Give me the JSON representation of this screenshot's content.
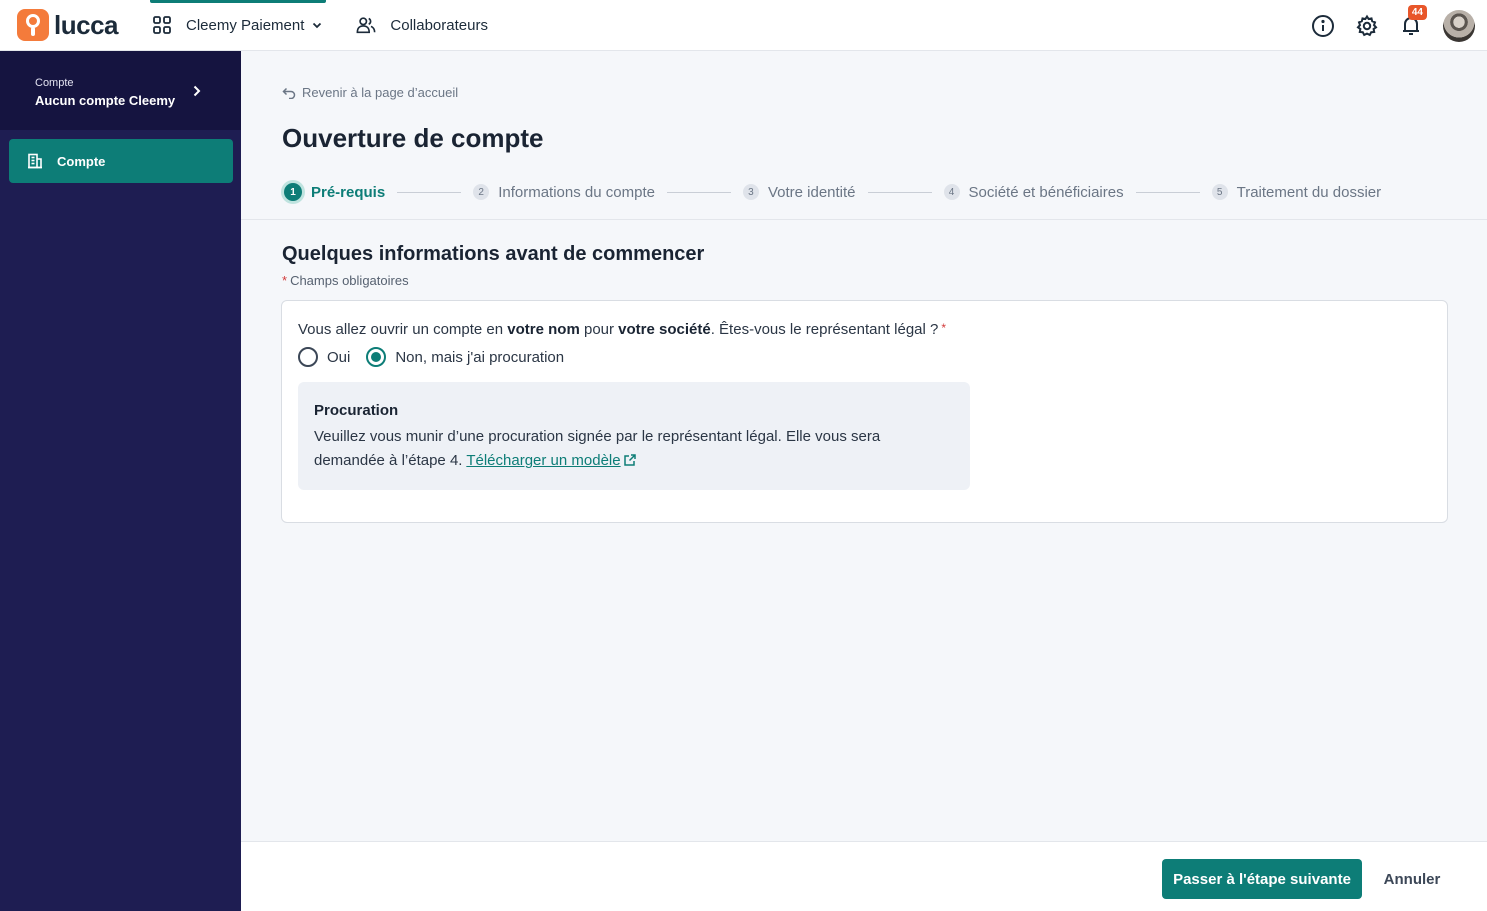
{
  "header": {
    "logo_text": "lucca",
    "app_switcher_label": "Cleemy Paiement",
    "collaborators_label": "Collaborateurs",
    "notification_count": "44",
    "icons": [
      "info-icon",
      "gear-icon",
      "bell-icon",
      "avatar"
    ]
  },
  "sidebar": {
    "account_label": "Compte",
    "account_value": "Aucun compte Cleemy",
    "items": [
      {
        "label": "Compte",
        "icon": "building-icon",
        "active": true
      }
    ]
  },
  "main": {
    "back_link": "Revenir à la page d’accueil",
    "title": "Ouverture de compte",
    "steps": [
      {
        "num": "1",
        "label": "Pré-requis",
        "active": true
      },
      {
        "num": "2",
        "label": "Informations du compte",
        "active": false
      },
      {
        "num": "3",
        "label": "Votre identité",
        "active": false
      },
      {
        "num": "4",
        "label": "Société et bénéficiaires",
        "active": false
      },
      {
        "num": "5",
        "label": "Traitement du dossier",
        "active": false
      }
    ],
    "section_title": "Quelques informations avant de commencer",
    "required_note": "Champs obligatoires",
    "question": {
      "part1": "Vous allez ouvrir un compte en ",
      "bold1": "votre nom",
      "part2": " pour ",
      "bold2": "votre société",
      "part3": ". Êtes-vous le représentant légal ?"
    },
    "options": [
      {
        "label": "Oui",
        "checked": false
      },
      {
        "label": "Non, mais j'ai procuration",
        "checked": true
      }
    ],
    "callout": {
      "title": "Procuration",
      "text": "Veuillez vous munir d’une procuration signée par le représentant légal. Elle vous sera demandée à l’étape 4. ",
      "link": "Télécharger un modèle"
    }
  },
  "footer": {
    "next_label": "Passer à l'étape suivante",
    "cancel_label": "Annuler"
  },
  "colors": {
    "accent": "#0d7d77",
    "sidebar_bg": "#1e1d52",
    "logo": "#f47b3b",
    "badge": "#e8562a"
  }
}
